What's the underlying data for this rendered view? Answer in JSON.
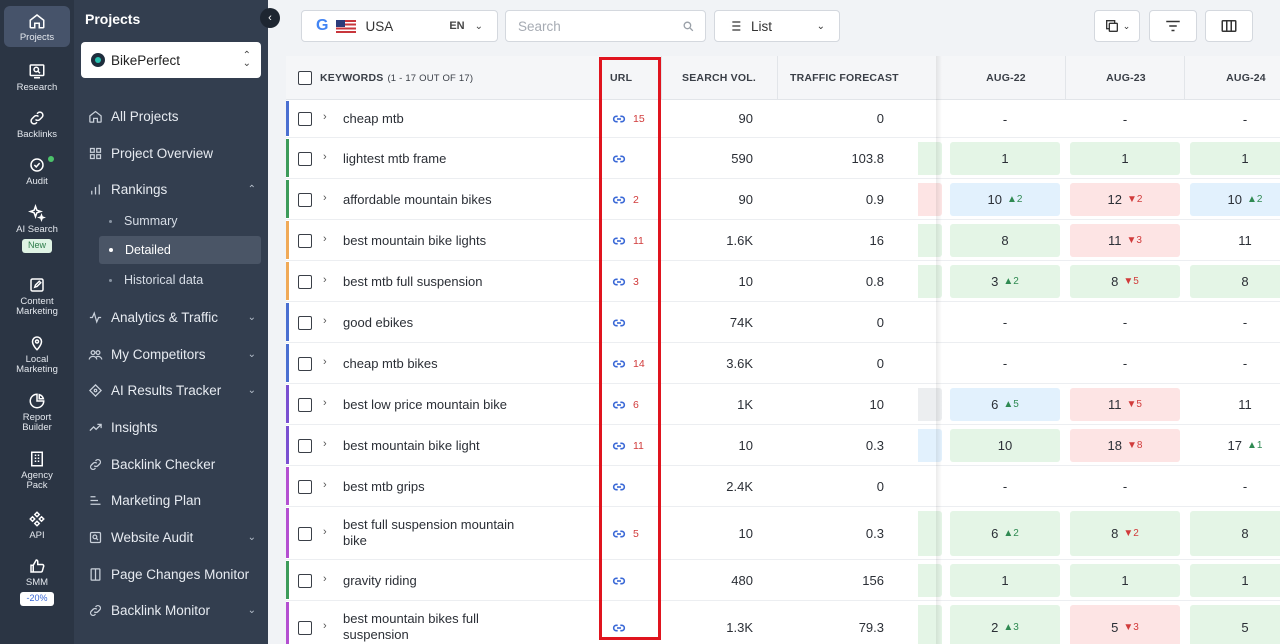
{
  "rail": [
    {
      "label": "Projects",
      "icon": "home-icon",
      "active": true
    },
    {
      "label": "Research",
      "icon": "research-icon"
    },
    {
      "label": "Backlinks",
      "icon": "link-icon"
    },
    {
      "label": "Audit",
      "icon": "audit-icon"
    },
    {
      "label": "AI Search",
      "icon": "sparkle-icon",
      "badge": "New"
    },
    {
      "label": "Content Marketing",
      "icon": "edit-icon"
    },
    {
      "label": "Local Marketing",
      "icon": "pin-icon"
    },
    {
      "label": "Report Builder",
      "icon": "pie-icon"
    },
    {
      "label": "Agency Pack",
      "icon": "building-icon"
    },
    {
      "label": "API",
      "icon": "api-icon"
    },
    {
      "label": "SMM",
      "icon": "thumbs-up-icon",
      "badge": "-20%"
    }
  ],
  "sidebar": {
    "title": "Projects",
    "project": "BikePerfect",
    "items": [
      {
        "label": "All Projects",
        "icon": "home-icon"
      },
      {
        "label": "Project Overview",
        "icon": "grid-icon"
      },
      {
        "label": "Rankings",
        "icon": "bars-icon",
        "expanded": true
      },
      {
        "label": "Analytics & Traffic",
        "icon": "analytics-icon"
      },
      {
        "label": "My Competitors",
        "icon": "people-icon"
      },
      {
        "label": "AI Results Tracker",
        "icon": "ai-tracker-icon"
      },
      {
        "label": "Insights",
        "icon": "insights-icon"
      },
      {
        "label": "Backlink Checker",
        "icon": "link-icon"
      },
      {
        "label": "Marketing Plan",
        "icon": "plan-icon"
      },
      {
        "label": "Website Audit",
        "icon": "audit-square-icon"
      },
      {
        "label": "Page Changes Monitor",
        "icon": "page-icon"
      },
      {
        "label": "Backlink Monitor",
        "icon": "link-icon"
      }
    ],
    "subitems": [
      {
        "label": "Summary"
      },
      {
        "label": "Detailed",
        "active": true
      },
      {
        "label": "Historical data"
      }
    ]
  },
  "toolbar": {
    "country": "USA",
    "lang": "EN",
    "search_placeholder": "Search",
    "view": "List"
  },
  "table": {
    "columns": {
      "keywords": "KEYWORDS",
      "keywords_count": "(1 - 17 OUT OF 17)",
      "url": "URL",
      "volume": "SEARCH VOL.",
      "traffic": "TRAFFIC FORECAST",
      "dates": [
        "AUG-22",
        "AUG-23",
        "AUG-24"
      ]
    },
    "rows": [
      {
        "kw": "cheap mtb",
        "url_count": "15",
        "vol": "90",
        "traffic": "0",
        "bar": "#4a6fd1",
        "frag": "",
        "pos": [
          {
            "v": "-",
            "c": ""
          },
          {
            "v": "-",
            "c": ""
          },
          {
            "v": "-",
            "c": ""
          }
        ]
      },
      {
        "kw": "lightest mtb frame",
        "url_count": "",
        "vol": "590",
        "traffic": "103.8",
        "bar": "#3d9b5a",
        "frag": "green",
        "pos": [
          {
            "v": "1",
            "c": "green"
          },
          {
            "v": "1",
            "c": "green"
          },
          {
            "v": "1",
            "c": "green"
          }
        ]
      },
      {
        "kw": "affordable mountain bikes",
        "url_count": "2",
        "vol": "90",
        "traffic": "0.9",
        "bar": "#3d9b5a",
        "frag": "red",
        "pos": [
          {
            "v": "10",
            "c": "blue",
            "chg": "2",
            "dir": "up"
          },
          {
            "v": "12",
            "c": "red",
            "chg": "2",
            "dir": "down"
          },
          {
            "v": "10",
            "c": "blue",
            "chg": "2",
            "dir": "up"
          }
        ]
      },
      {
        "kw": "best mountain bike lights",
        "url_count": "11",
        "vol": "1.6K",
        "traffic": "16",
        "bar": "#f0a957",
        "frag": "green",
        "pos": [
          {
            "v": "8",
            "c": "green"
          },
          {
            "v": "11",
            "c": "red",
            "chg": "3",
            "dir": "down"
          },
          {
            "v": "11",
            "c": ""
          }
        ]
      },
      {
        "kw": "best mtb full suspension",
        "url_count": "3",
        "vol": "10",
        "traffic": "0.8",
        "bar": "#f0a957",
        "frag": "green",
        "pos": [
          {
            "v": "3",
            "c": "green",
            "chg": "2",
            "dir": "up"
          },
          {
            "v": "8",
            "c": "green",
            "chg": "5",
            "dir": "down"
          },
          {
            "v": "8",
            "c": "green"
          }
        ]
      },
      {
        "kw": "good ebikes",
        "url_count": "",
        "vol": "74K",
        "traffic": "0",
        "bar": "#4a6fd1",
        "frag": "",
        "pos": [
          {
            "v": "-",
            "c": ""
          },
          {
            "v": "-",
            "c": ""
          },
          {
            "v": "-",
            "c": ""
          }
        ]
      },
      {
        "kw": "cheap mtb bikes",
        "url_count": "14",
        "vol": "3.6K",
        "traffic": "0",
        "bar": "#4a6fd1",
        "frag": "",
        "pos": [
          {
            "v": "-",
            "c": ""
          },
          {
            "v": "-",
            "c": ""
          },
          {
            "v": "-",
            "c": ""
          }
        ]
      },
      {
        "kw": "best low price mountain bike",
        "url_count": "6",
        "vol": "1K",
        "traffic": "10",
        "bar": "#7a4fd1",
        "frag": "gray",
        "pos": [
          {
            "v": "6",
            "c": "blue",
            "chg": "5",
            "dir": "up"
          },
          {
            "v": "11",
            "c": "red",
            "chg": "5",
            "dir": "down"
          },
          {
            "v": "11",
            "c": ""
          }
        ]
      },
      {
        "kw": "best mountain bike light",
        "url_count": "11",
        "vol": "10",
        "traffic": "0.3",
        "bar": "#7a4fd1",
        "frag": "blue",
        "pos": [
          {
            "v": "10",
            "c": "green"
          },
          {
            "v": "18",
            "c": "red",
            "chg": "8",
            "dir": "down"
          },
          {
            "v": "17",
            "c": "",
            "chg": "1",
            "dir": "up"
          }
        ]
      },
      {
        "kw": "best mtb grips",
        "url_count": "",
        "vol": "2.4K",
        "traffic": "0",
        "bar": "#b44fd1",
        "frag": "",
        "pos": [
          {
            "v": "-",
            "c": ""
          },
          {
            "v": "-",
            "c": ""
          },
          {
            "v": "-",
            "c": ""
          }
        ]
      },
      {
        "kw": "best full suspension mountain bike",
        "url_count": "5",
        "vol": "10",
        "traffic": "0.3",
        "bar": "#b44fd1",
        "frag": "green",
        "pos": [
          {
            "v": "6",
            "c": "green",
            "chg": "2",
            "dir": "up"
          },
          {
            "v": "8",
            "c": "green",
            "chg": "2",
            "dir": "down"
          },
          {
            "v": "8",
            "c": "green"
          }
        ]
      },
      {
        "kw": "gravity riding",
        "url_count": "",
        "vol": "480",
        "traffic": "156",
        "bar": "#3d9b5a",
        "frag": "green",
        "pos": [
          {
            "v": "1",
            "c": "green"
          },
          {
            "v": "1",
            "c": "green"
          },
          {
            "v": "1",
            "c": "green"
          }
        ]
      },
      {
        "kw": "best mountain bikes full suspension",
        "url_count": "",
        "vol": "1.3K",
        "traffic": "79.3",
        "bar": "#b44fd1",
        "frag": "green",
        "pos": [
          {
            "v": "2",
            "c": "green",
            "chg": "3",
            "dir": "up"
          },
          {
            "v": "5",
            "c": "red",
            "chg": "3",
            "dir": "down"
          },
          {
            "v": "5",
            "c": "green"
          }
        ]
      }
    ]
  },
  "colors": {
    "highlight": "#e0141e",
    "accent": "#3867d6",
    "up": "#2f8a52",
    "down": "#d13b3b"
  }
}
